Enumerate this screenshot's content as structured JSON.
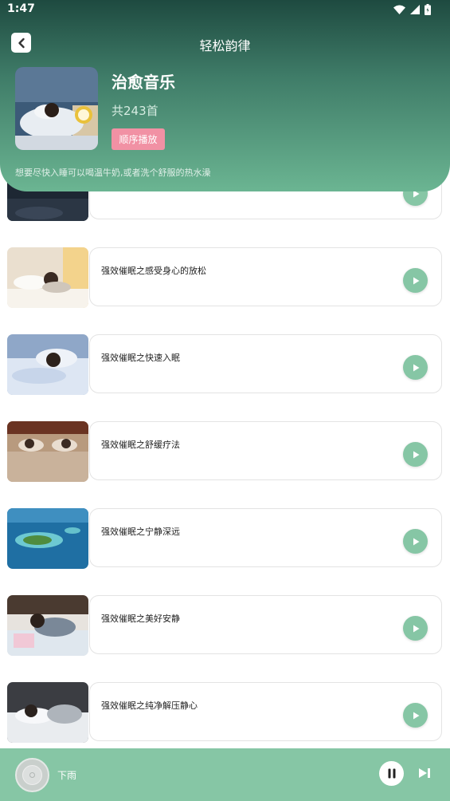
{
  "status_bar": {
    "time": "1:47"
  },
  "nav": {
    "title": "轻松韵律"
  },
  "album": {
    "title": "治愈音乐",
    "count": "共243首",
    "play_order_label": "顺序播放",
    "description": "想要尽快入睡可以喝温牛奶,或者洗个舒服的热水澡"
  },
  "tracks": [
    {
      "title": "",
      "icon": "play-icon"
    },
    {
      "title": "强效催眠之感受身心的放松",
      "icon": "play-icon"
    },
    {
      "title": "强效催眠之快速入眠",
      "icon": "play-icon"
    },
    {
      "title": "强效催眠之舒缓疗法",
      "icon": "play-icon"
    },
    {
      "title": "强效催眠之宁静深远",
      "icon": "play-icon"
    },
    {
      "title": "强效催眠之美好安静",
      "icon": "play-icon"
    },
    {
      "title": "强效催眠之纯净解压静心",
      "icon": "play-icon"
    }
  ],
  "player": {
    "now_playing": "下雨",
    "icons": [
      "disc-icon",
      "pause-icon",
      "skip-next-icon"
    ]
  },
  "colors": {
    "accent": "#86c6a5",
    "pink_button": "#f191a4",
    "header_top": "#1e4a40",
    "header_bottom": "#6bb592"
  }
}
